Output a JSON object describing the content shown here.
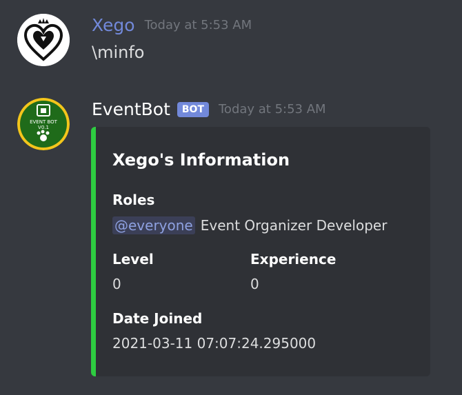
{
  "messages": [
    {
      "username": "Xego",
      "timestamp": "Today at 5:53 AM",
      "content": "\\minfo",
      "avatar_icon": "kingdom-hearts-heart-crown-icon"
    },
    {
      "username": "EventBot",
      "bot_tag": "BOT",
      "timestamp": "Today at 5:53 AM",
      "avatar_icon": "eventbot-logo-icon",
      "avatar_text_line1": "EVENT BOT",
      "avatar_text_line2": "V0.1",
      "embed": {
        "accent_color": "#2ecc41",
        "title": "Xego's Information",
        "fields": {
          "roles": {
            "name": "Roles",
            "mention": "@everyone",
            "value": "Event Organizer Developer"
          },
          "level": {
            "name": "Level",
            "value": "0"
          },
          "experience": {
            "name": "Experience",
            "value": "0"
          },
          "date_joined": {
            "name": "Date Joined",
            "value": "2021-03-11 07:07:24.295000"
          }
        }
      }
    }
  ],
  "colors": {
    "background": "#36393f",
    "embed_background": "#2f3136",
    "username_link": "#7289da",
    "bot_tag": "#7289da",
    "timestamp": "#72767d",
    "mention_text": "#8ea1e1"
  }
}
